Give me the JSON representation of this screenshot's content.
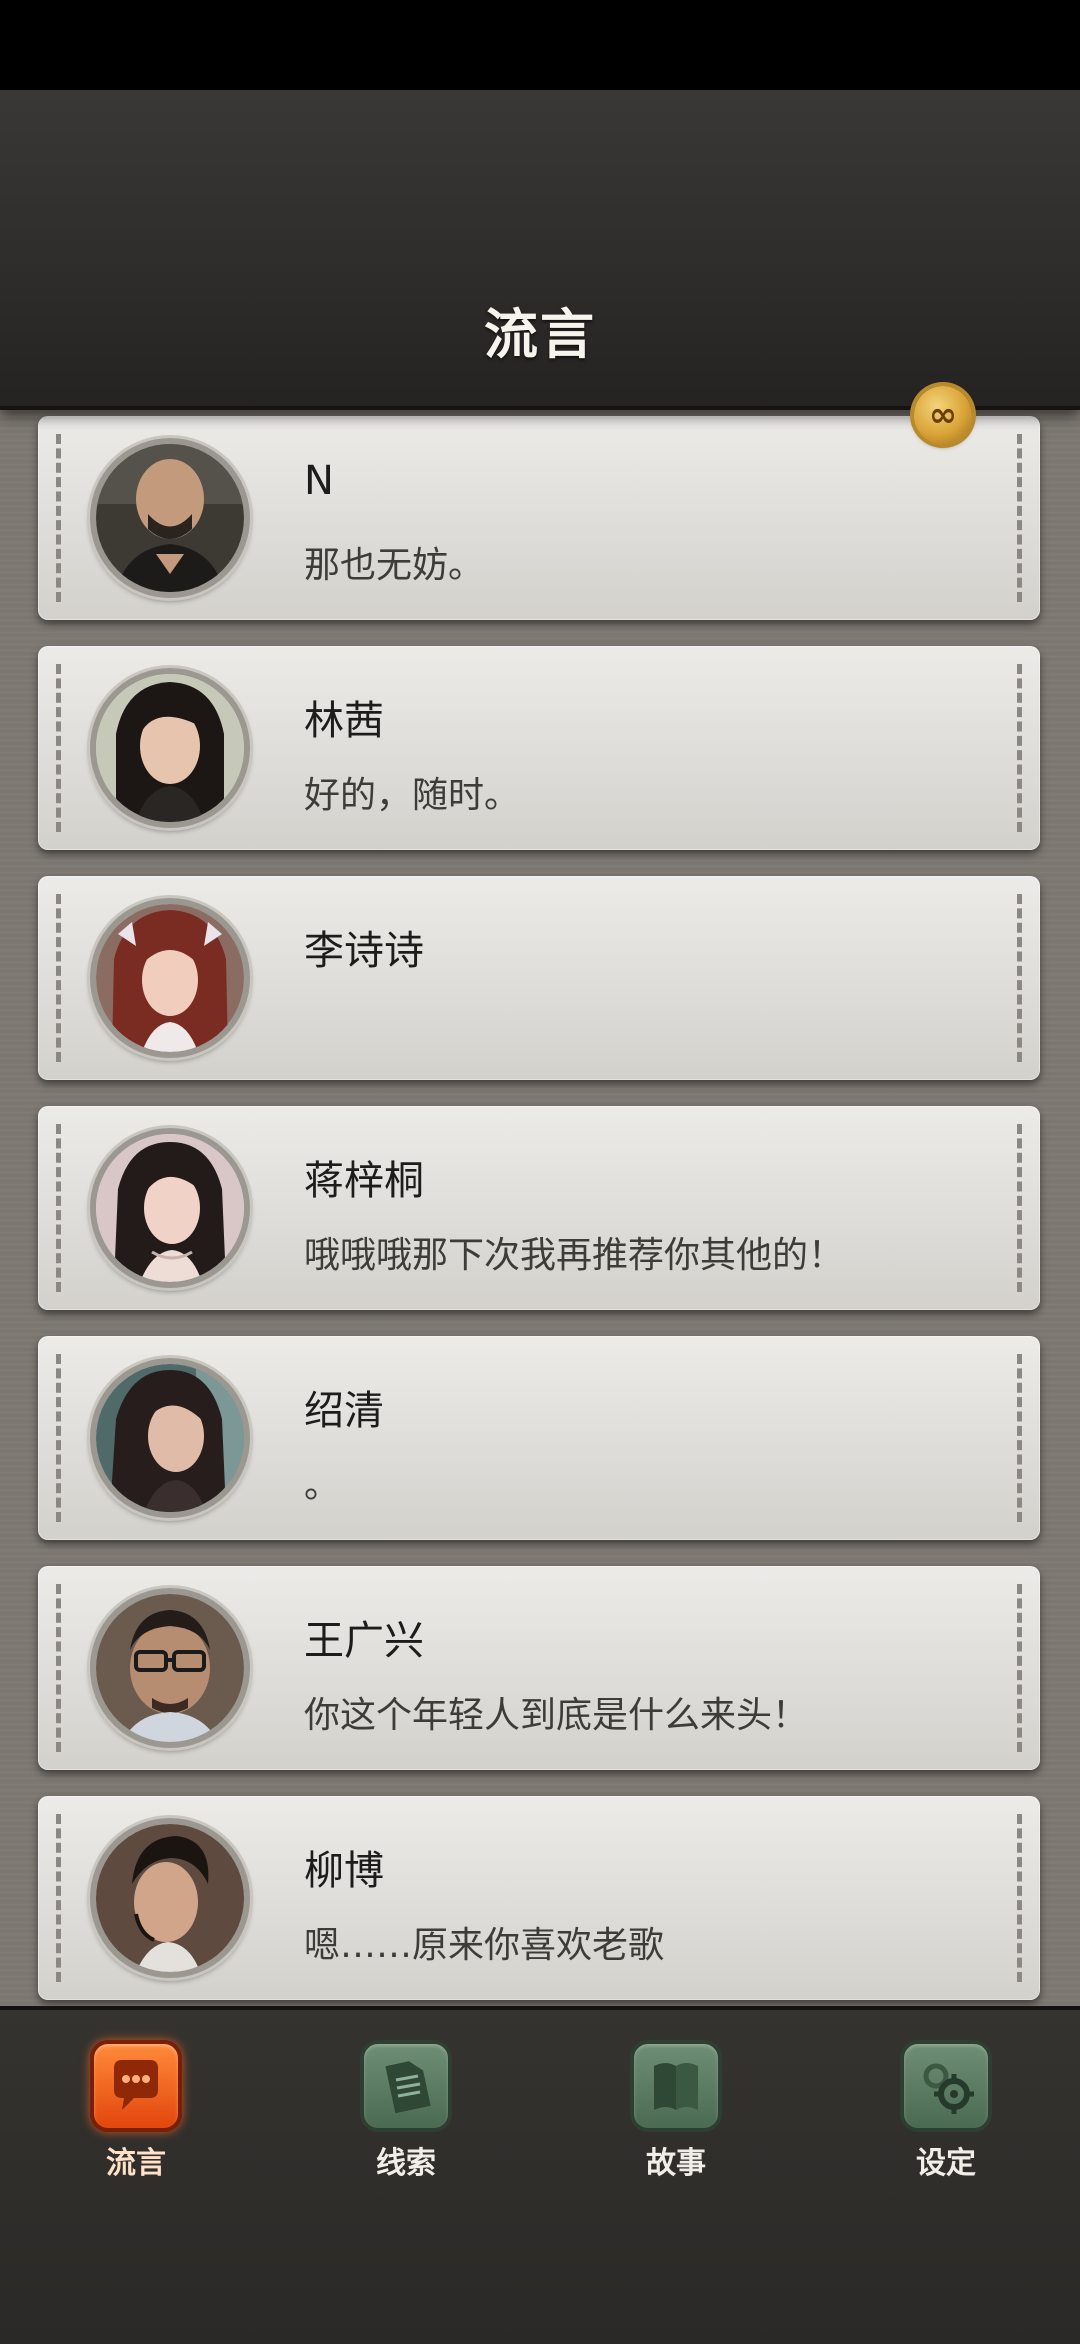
{
  "header": {
    "title": "流言",
    "badge_icon": "infinity-coin-icon",
    "badge_symbol": "∞"
  },
  "contacts": [
    {
      "name": "N",
      "message": "那也无妨。"
    },
    {
      "name": "林茜",
      "message": "好的，随时。"
    },
    {
      "name": "李诗诗",
      "message": ""
    },
    {
      "name": "蒋梓桐",
      "message": "哦哦哦那下次我再推荐你其他的！"
    },
    {
      "name": "绍清",
      "message": "。"
    },
    {
      "name": "王广兴",
      "message": "你这个年轻人到底是什么来头！"
    },
    {
      "name": "柳博",
      "message": "嗯……原来你喜欢老歌"
    }
  ],
  "tabs": [
    {
      "label": "流言",
      "icon": "chat-bubble-icon",
      "active": true
    },
    {
      "label": "线索",
      "icon": "document-icon",
      "active": false
    },
    {
      "label": "故事",
      "icon": "book-icon",
      "active": false
    },
    {
      "label": "设定",
      "icon": "gear-icon",
      "active": false
    }
  ],
  "colors": {
    "active_tab": "#e2460c",
    "inactive_tab": "#4a6a52",
    "badge_gold": "#d9a437"
  }
}
